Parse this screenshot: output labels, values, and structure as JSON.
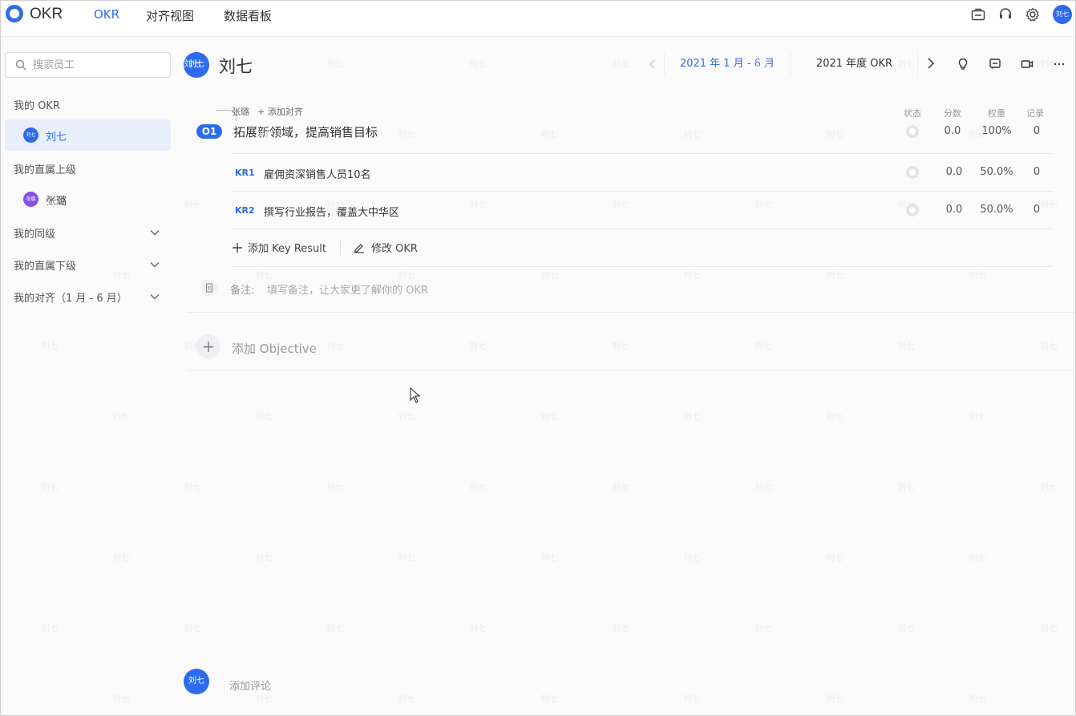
{
  "app": {
    "title": "OKR"
  },
  "nav": {
    "tabs": [
      "OKR",
      "对齐视图",
      "数据看板"
    ],
    "active": 0
  },
  "header_icons": [
    "briefcase-icon",
    "headset-icon",
    "gear-icon"
  ],
  "current_user": {
    "name": "刘七",
    "avatar_text": "刘七",
    "avatar_color": "#2d6bed"
  },
  "sidebar": {
    "search_placeholder": "搜索员工",
    "sections": {
      "my_okr": "我的 OKR",
      "my_superior": "我的直属上级",
      "my_peers": "我的同级",
      "my_subordinates": "我的直属下级",
      "my_alignment": "我的对齐（1 月 - 6 月）"
    },
    "my_okr_user": {
      "name": "刘七",
      "avatar_text": "刘七"
    },
    "superior_user": {
      "name": "张璐",
      "avatar_text": "张璐",
      "avatar_color": "#8b4cf0"
    }
  },
  "main": {
    "owner": {
      "name": "刘七",
      "avatar_text": "刘七"
    },
    "period_label": "2021 年 1 月 - 6 月",
    "year_label": "2021 年度 OKR",
    "columns": {
      "status": "状态",
      "score": "分数",
      "weight": "权重",
      "records": "记录"
    },
    "objective": {
      "badge": "O1",
      "title": "拓展新领域，提高销售目标",
      "aligned_to": "张璐",
      "add_align_label": "添加对齐",
      "score": "0.0",
      "weight": "100%",
      "records": "0"
    },
    "key_results": [
      {
        "code": "KR1",
        "title": "雇佣资深销售人员10名",
        "score": "0.0",
        "weight": "50.0%",
        "records": "0"
      },
      {
        "code": "KR2",
        "title": "撰写行业报告，覆盖大中华区",
        "score": "0.0",
        "weight": "50.0%",
        "records": "0"
      }
    ],
    "actions": {
      "add_kr": "添加 Key Result",
      "edit_okr": "修改 OKR"
    },
    "note": {
      "label": "备注:",
      "placeholder": "填写备注，让大家更了解你的 OKR"
    },
    "add_objective": "添加 Objective",
    "comment": {
      "avatar_text": "刘七",
      "placeholder": "添加评论"
    }
  },
  "watermark_text": "刘七"
}
